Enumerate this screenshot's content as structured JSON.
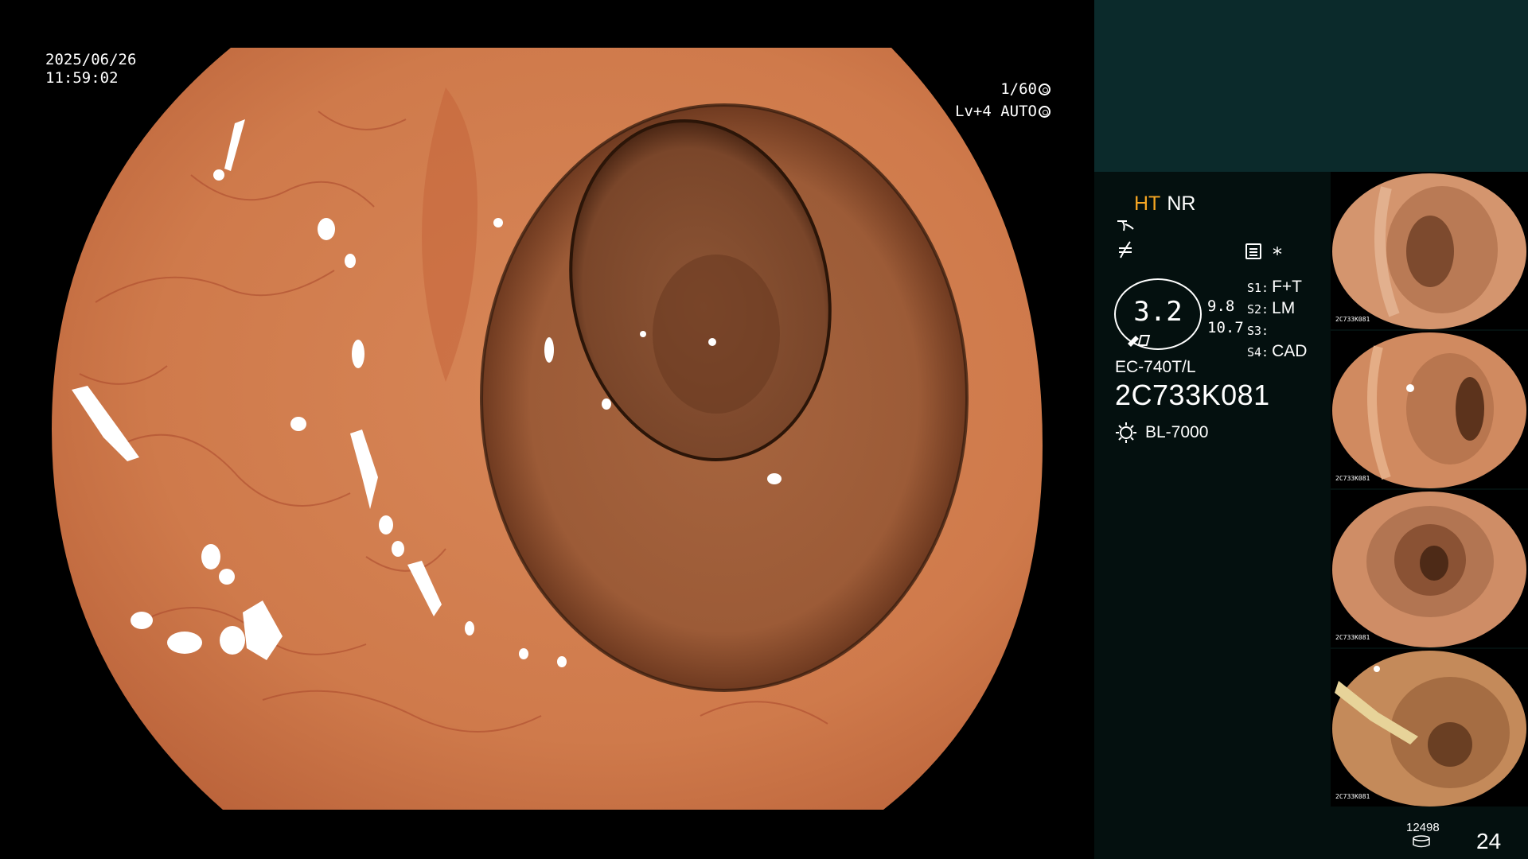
{
  "overlay": {
    "date": "2025/06/26",
    "time": "11:59:02",
    "shutter": "1/60",
    "level": "Lv+4 AUTO"
  },
  "panel": {
    "mode_ht": "HT",
    "mode_nr": "NR",
    "star": "*",
    "zoom": "3.2",
    "zoom_values": [
      "9.8",
      "10.7"
    ],
    "switches": [
      {
        "key": "S1:",
        "value": "F+T"
      },
      {
        "key": "S2:",
        "value": "LM"
      },
      {
        "key": "S3:",
        "value": ""
      },
      {
        "key": "S4:",
        "value": "CAD"
      }
    ],
    "scope_model": "EC-740T/L",
    "scope_serial": "2C733K081",
    "light_source": "BL-7000",
    "thumbnail_serial": "2C733K081",
    "image_counter": "12498",
    "frame_number": "24"
  },
  "icons": {
    "shutter_icon": "aperture-icon",
    "auto_icon": "auto-iris-icon",
    "curve_icon": "tone-curve-icon",
    "filter_icon": "filter-icon",
    "menu_icon": "menu-list-icon",
    "sun_icon": "light-source-icon",
    "disk_icon": "storage-icon"
  },
  "colors": {
    "accent_ht": "#f6a623",
    "panel_bg": "#04100f",
    "panel_top_bg": "#0b2a2b"
  }
}
